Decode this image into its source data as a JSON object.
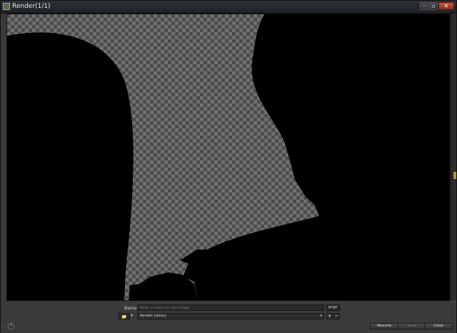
{
  "window": {
    "title": "Render(1/1)",
    "controls": {
      "minimize": "–",
      "maximize": "▫",
      "close": "✕"
    }
  },
  "form": {
    "name_label": "Name",
    "name_placeholder": "Enter a name for the image",
    "format_value": "png",
    "library_value": "Render Library"
  },
  "actions": {
    "help": "?",
    "add": "+",
    "remove": "−",
    "resume": "Resume",
    "save": "Save",
    "close": "Close"
  },
  "icons": {
    "app": "app-icon",
    "folder": "folder-icon",
    "caret": "▾"
  },
  "colors": {
    "silhouette": "#000000",
    "checker_light": "#6f6f6f",
    "checker_dark": "#4c4c4c",
    "close_accent": "#b03a2e"
  }
}
